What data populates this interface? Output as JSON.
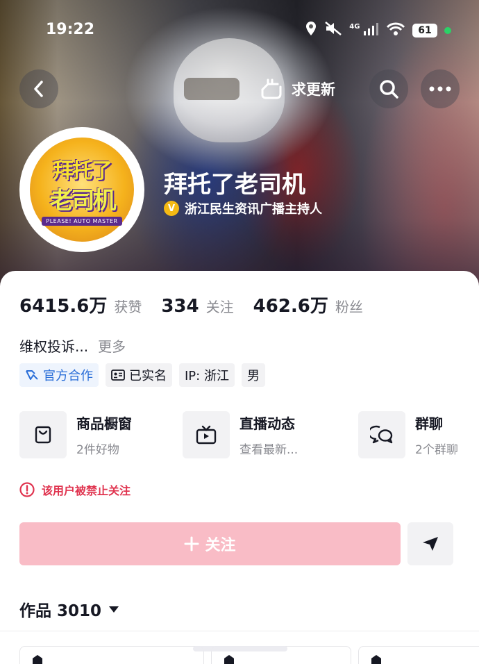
{
  "status_bar": {
    "time": "19:22",
    "network": "4G",
    "battery": "61"
  },
  "nav": {
    "update_label": "求更新"
  },
  "profile": {
    "avatar_text": {
      "line1": "拜托了",
      "line2": "老司机",
      "tagline": "PLEASE! AUTO MASTER"
    },
    "name": "拜托了老司机",
    "verification": "浙江民生资讯广播主持人"
  },
  "stats": [
    {
      "value": "6415.6万",
      "label": "获赞"
    },
    {
      "value": "334",
      "label": "关注"
    },
    {
      "value": "462.6万",
      "label": "粉丝"
    }
  ],
  "bio": {
    "text": "维权投诉...",
    "more": "更多"
  },
  "tags": [
    {
      "label": "官方合作",
      "icon": "handshake-icon"
    },
    {
      "label": "已实名",
      "icon": "id-card-icon"
    },
    {
      "label": "IP: 浙江",
      "icon": ""
    },
    {
      "label": "男",
      "icon": ""
    }
  ],
  "shortcuts": [
    {
      "title": "商品橱窗",
      "subtitle": "2件好物",
      "icon": "shopping-bag-icon"
    },
    {
      "title": "直播动态",
      "subtitle": "查看最新...",
      "icon": "tv-icon"
    },
    {
      "title": "群聊",
      "subtitle": "2个群聊",
      "icon": "chat-bubbles-icon"
    }
  ],
  "warning": "该用户被禁止关注",
  "follow_button": "关注",
  "works": {
    "label": "作品 3010"
  },
  "colors": {
    "follow_disabled": "#f9bcc6",
    "warning": "#e0344f",
    "official_tag": "#2a6ed8",
    "verify_badge": "#f4b914"
  }
}
